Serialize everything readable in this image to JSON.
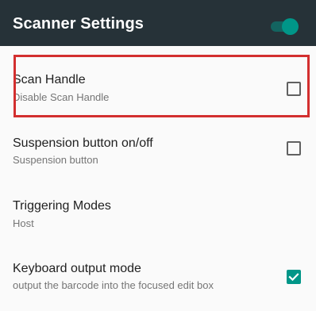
{
  "appbar": {
    "title": "Scanner Settings",
    "switch_on": true
  },
  "colors": {
    "appbar_bg": "#263238",
    "accent": "#009688",
    "highlight": "#d32f2f"
  },
  "settings": [
    {
      "title": "Scan Handle",
      "summary": "Disable Scan Handle",
      "checked": false
    },
    {
      "title": "Suspension button on/off",
      "summary": "Suspension button",
      "checked": false
    },
    {
      "title": "Triggering Modes",
      "summary": "Host"
    },
    {
      "title": "Keyboard output mode",
      "summary": "output the barcode into the focused edit box",
      "checked": true
    }
  ]
}
